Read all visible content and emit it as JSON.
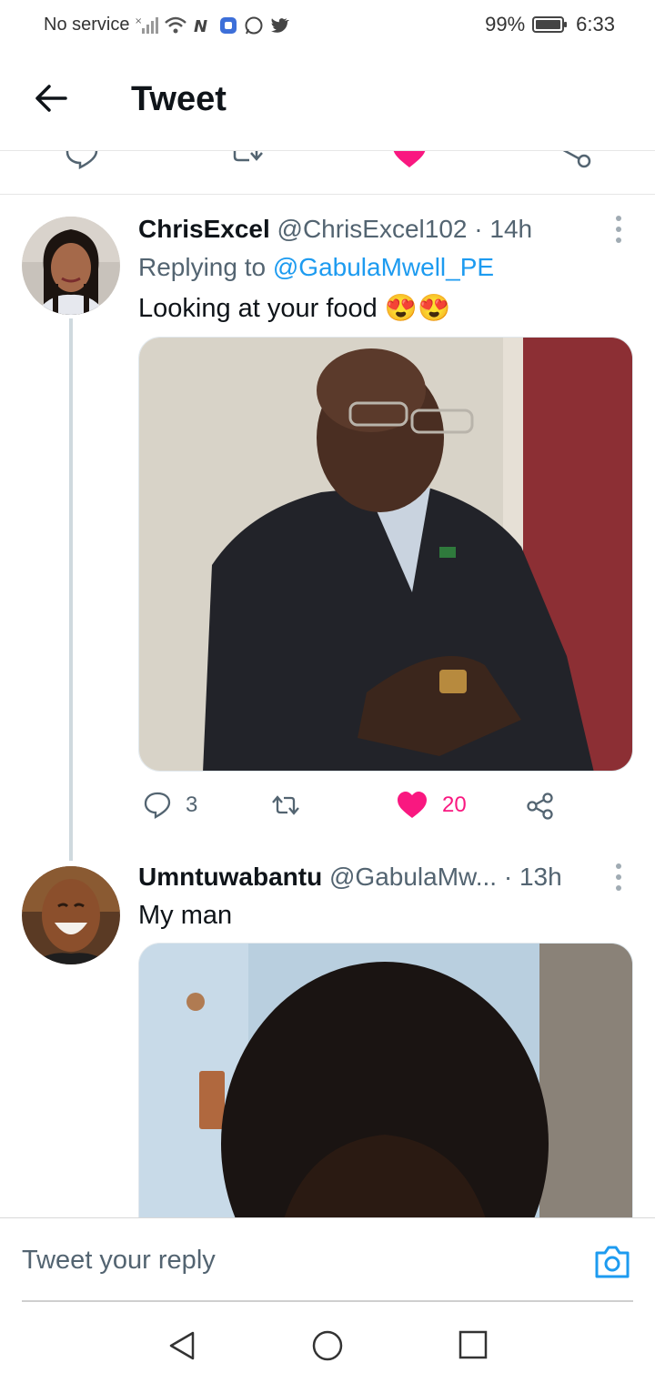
{
  "status_bar": {
    "carrier": "No service",
    "battery": "99%",
    "time": "6:33"
  },
  "header": {
    "title": "Tweet"
  },
  "tweets": [
    {
      "name": "ChrisExcel",
      "handle": "@ChrisExcel102",
      "separator": "·",
      "time": "14h",
      "replying_prefix": "Replying to",
      "replying_to": "@GabulaMwell_PE",
      "text": "Looking at your food 😍😍",
      "replies": "3",
      "likes": "20"
    },
    {
      "name": "Umntuwabantu",
      "handle": "@GabulaMw...",
      "separator": "·",
      "time": "13h",
      "text": "My man"
    }
  ],
  "reply_bar": {
    "placeholder": "Tweet your reply"
  },
  "colors": {
    "accent": "#1d9bf0",
    "like": "#f91880",
    "muted": "#536471"
  }
}
